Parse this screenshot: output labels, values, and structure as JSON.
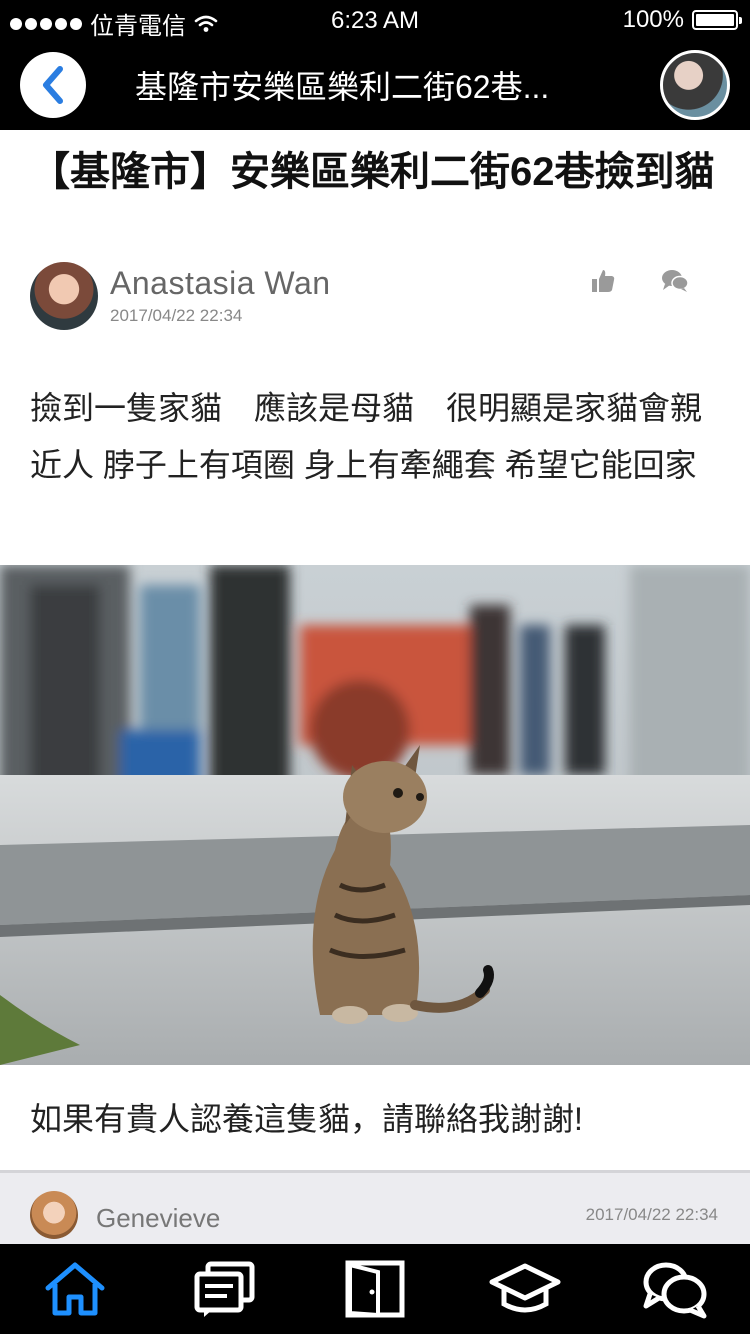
{
  "status_bar": {
    "carrier": "位青電信",
    "time": "6:23 AM",
    "battery": "100%",
    "battery_level": 1.0
  },
  "nav": {
    "title": "基隆市安樂區樂利二街62巷..."
  },
  "article": {
    "title": "【基隆市】安樂區樂利二街62巷撿到貓",
    "author": "Anastasia Wan",
    "date": "2017/04/22 22:34",
    "body": "撿到一隻家貓　應該是母貓　很明顯是家貓會親近人  脖子上有項圈  身上有牽繩套  希望它能回家",
    "closing": "如果有貴人認養這隻貓，請聯絡我謝謝!"
  },
  "comment_preview": {
    "name": "Genevieve",
    "date": "2017/04/22 22:34"
  },
  "tabs": [
    {
      "icon": "home-icon",
      "active": true
    },
    {
      "icon": "posts-icon",
      "active": false
    },
    {
      "icon": "door-icon",
      "active": false
    },
    {
      "icon": "school-icon",
      "active": false
    },
    {
      "icon": "chat-icon",
      "active": false
    }
  ],
  "colors": {
    "accent": "#1e90ff",
    "bar": "#000000"
  }
}
